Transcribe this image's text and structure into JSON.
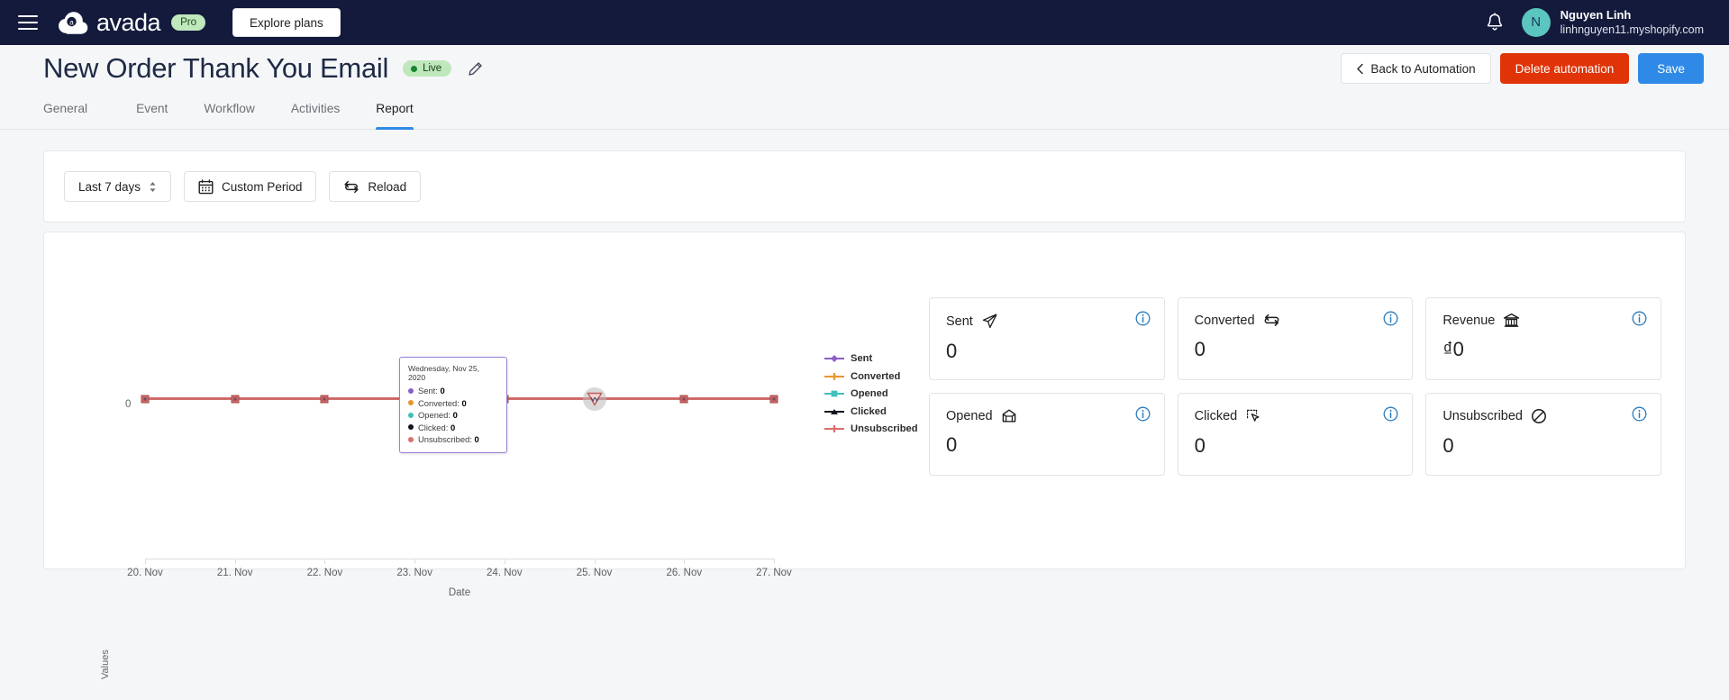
{
  "topbar": {
    "menu_icon": "hamburger-icon",
    "brand": "avada",
    "plan_badge": "Pro",
    "explore_label": "Explore plans",
    "bell_icon": "notification-bell-icon",
    "avatar_initial": "N",
    "user_name": "Nguyen Linh",
    "user_shop": "linhnguyen11.myshopify.com"
  },
  "header": {
    "title": "New Order Thank You Email",
    "status_badge": "Live",
    "edit_icon": "pencil-icon",
    "back_label": "Back to Automation",
    "back_icon": "chevron-left-icon",
    "delete_label": "Delete automation",
    "save_label": "Save",
    "colors": {
      "danger": "#e03307",
      "primary": "#2e8ae6",
      "live": "#bfe8bc"
    }
  },
  "tabs": [
    {
      "label": "General",
      "active": false
    },
    {
      "label": "Event",
      "active": false
    },
    {
      "label": "Workflow",
      "active": false
    },
    {
      "label": "Activities",
      "active": false
    },
    {
      "label": "Report",
      "active": true
    }
  ],
  "filters": {
    "range_value": "Last 7 days",
    "range_icon": "stepper-updown-icon",
    "custom_label": "Custom Period",
    "custom_icon": "calendar-icon",
    "reload_label": "Reload",
    "reload_icon": "refresh-icon"
  },
  "tooltip": {
    "date": "Wednesday, Nov 25, 2020",
    "rows": [
      {
        "label": "Sent",
        "value": "0",
        "color": "#8b5fc7"
      },
      {
        "label": "Converted",
        "value": "0",
        "color": "#e8962e"
      },
      {
        "label": "Opened",
        "value": "0",
        "color": "#3fc0bd"
      },
      {
        "label": "Clicked",
        "value": "0",
        "color": "#101420"
      },
      {
        "label": "Unsubscribed",
        "value": "0",
        "color": "#d96f6c"
      }
    ]
  },
  "stats": [
    {
      "label": "Sent",
      "value": "0",
      "icon": "paper-plane-icon",
      "info_icon": "info-circle-icon"
    },
    {
      "label": "Converted",
      "value": "0",
      "icon": "exchange-arrows-icon",
      "info_icon": "info-circle-icon"
    },
    {
      "label": "Revenue",
      "value": "₫0",
      "icon": "bank-icon",
      "info_icon": "info-circle-icon"
    },
    {
      "label": "Opened",
      "value": "0",
      "icon": "envelope-open-icon",
      "info_icon": "info-circle-icon"
    },
    {
      "label": "Clicked",
      "value": "0",
      "icon": "cursor-click-icon",
      "info_icon": "info-circle-icon"
    },
    {
      "label": "Unsubscribed",
      "value": "0",
      "icon": "ban-icon",
      "info_icon": "info-circle-icon"
    }
  ],
  "chart_data": {
    "type": "line",
    "title": "",
    "xlabel": "Date",
    "ylabel": "Values",
    "x": [
      "20. Nov",
      "21. Nov",
      "22. Nov",
      "23. Nov",
      "24. Nov",
      "25. Nov",
      "26. Nov",
      "27. Nov"
    ],
    "yticks": [
      "0"
    ],
    "ylim": [
      0,
      0
    ],
    "grid": false,
    "legend_position": "right",
    "hover_index": 5,
    "series": [
      {
        "name": "Sent",
        "values": [
          0,
          0,
          0,
          0,
          0,
          0,
          0,
          0
        ],
        "color": "#8b5fc7",
        "marker": "diamond"
      },
      {
        "name": "Converted",
        "values": [
          0,
          0,
          0,
          0,
          0,
          0,
          0,
          0
        ],
        "color": "#e8962e",
        "marker": "plus"
      },
      {
        "name": "Opened",
        "values": [
          0,
          0,
          0,
          0,
          0,
          0,
          0,
          0
        ],
        "color": "#3fc0bd",
        "marker": "square"
      },
      {
        "name": "Clicked",
        "values": [
          0,
          0,
          0,
          0,
          0,
          0,
          0,
          0
        ],
        "color": "#101420",
        "marker": "triangle"
      },
      {
        "name": "Unsubscribed",
        "values": [
          0,
          0,
          0,
          0,
          0,
          0,
          0,
          0
        ],
        "color": "#d96f6c",
        "marker": "cross"
      }
    ]
  }
}
